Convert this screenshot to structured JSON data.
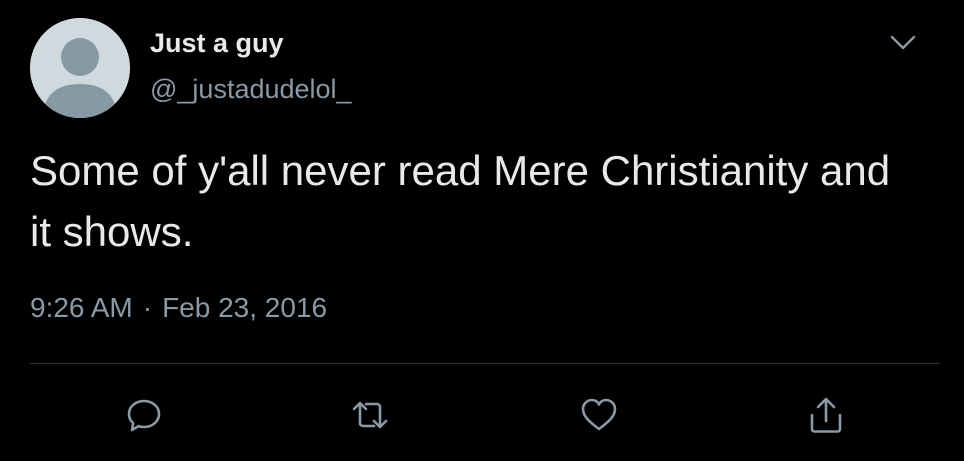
{
  "tweet": {
    "display_name": "Just a guy",
    "handle": "@_justadudelol_",
    "text": "Some of y'all never read Mere Christianity and it shows.",
    "time": "9:26 AM",
    "separator": "·",
    "date": "Feb 23, 2016"
  },
  "icons": {
    "more": "chevron-down-icon",
    "reply": "reply-icon",
    "retweet": "retweet-icon",
    "like": "heart-icon",
    "share": "share-icon"
  },
  "colors": {
    "background": "#000000",
    "primary_text": "#e7e9ea",
    "secondary_text": "#8b98a5",
    "divider": "#2f3336",
    "avatar_bg": "#cfd9de",
    "avatar_fg": "#8899a6"
  }
}
